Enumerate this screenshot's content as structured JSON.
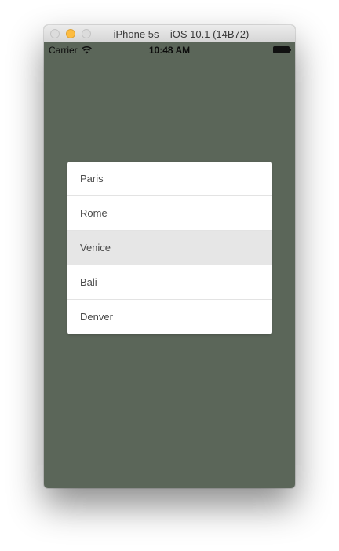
{
  "window": {
    "title": "iPhone 5s – iOS 10.1 (14B72)"
  },
  "statusbar": {
    "carrier": "Carrier",
    "time": "10:48 AM",
    "wifi_icon": "wifi-icon",
    "battery_icon": "battery-icon"
  },
  "picker": {
    "items": [
      {
        "label": "Paris",
        "selected": false
      },
      {
        "label": "Rome",
        "selected": false
      },
      {
        "label": "Venice",
        "selected": true
      },
      {
        "label": "Bali",
        "selected": false
      },
      {
        "label": "Denver",
        "selected": false
      }
    ]
  },
  "colors": {
    "background": "#5b6659",
    "list_background": "#ffffff",
    "selected_row": "#e6e6e6"
  }
}
